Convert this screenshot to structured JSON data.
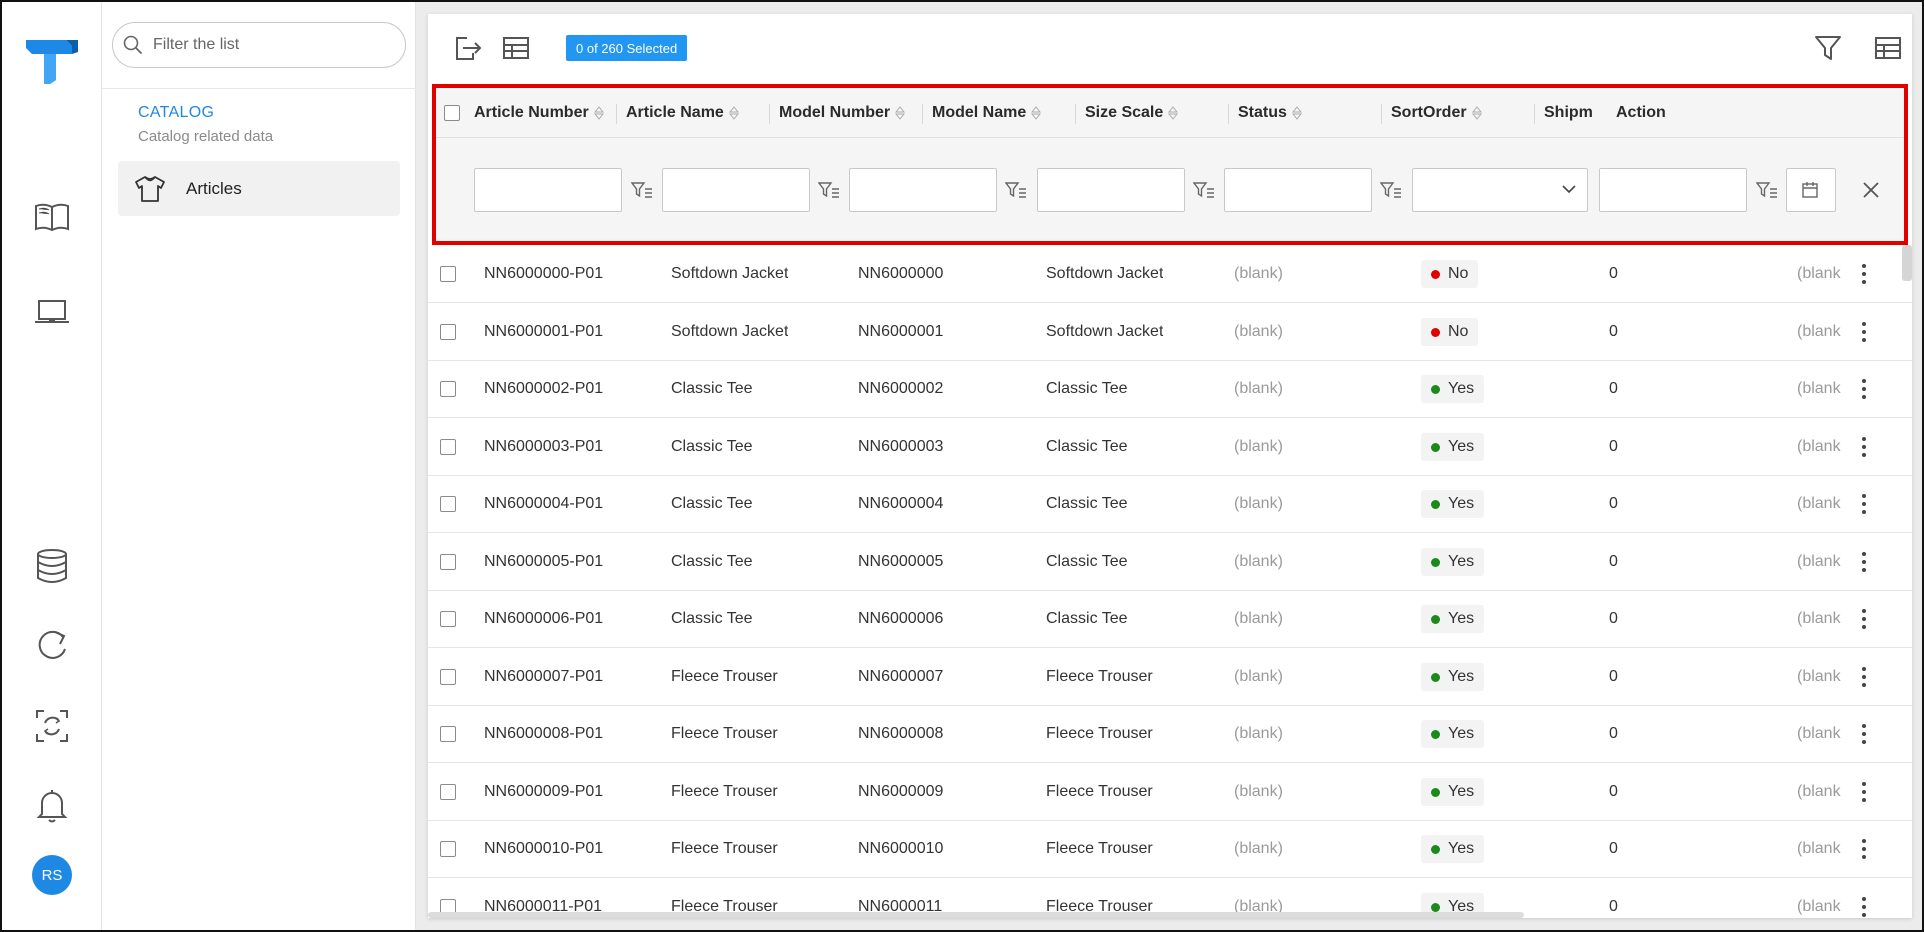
{
  "rail": {
    "logo_icon": "brand-logo",
    "icons": [
      "book-icon",
      "laptop-icon",
      "database-icon",
      "refresh-icon",
      "sync-icon",
      "bell-icon"
    ],
    "avatar_initials": "RS",
    "accent": "#1e88e5"
  },
  "panel": {
    "search_placeholder": "Filter the list",
    "section_title": "CATALOG",
    "section_subtitle": "Catalog related data",
    "nav_item": "Articles"
  },
  "toolbar": {
    "selected_badge": "0 of 260 Selected"
  },
  "columns": [
    "Article Number",
    "Article Name",
    "Model Number",
    "Model Name",
    "Size Scale",
    "Status",
    "SortOrder",
    "Shipm",
    "Action"
  ],
  "status_colors": {
    "No": "#e00000",
    "Yes": "#1a8a1a"
  },
  "highlight_color": "#e00000",
  "rows": [
    {
      "article_number": "NN6000000-P01",
      "article_name": "Softdown Jacket",
      "model_number": "NN6000000",
      "model_name": "Softdown Jacket",
      "size_scale": "(blank)",
      "status": "No",
      "sort_order": "0",
      "shipment": "(blank"
    },
    {
      "article_number": "NN6000001-P01",
      "article_name": "Softdown Jacket",
      "model_number": "NN6000001",
      "model_name": "Softdown Jacket",
      "size_scale": "(blank)",
      "status": "No",
      "sort_order": "0",
      "shipment": "(blank"
    },
    {
      "article_number": "NN6000002-P01",
      "article_name": "Classic Tee",
      "model_number": "NN6000002",
      "model_name": "Classic Tee",
      "size_scale": "(blank)",
      "status": "Yes",
      "sort_order": "0",
      "shipment": "(blank"
    },
    {
      "article_number": "NN6000003-P01",
      "article_name": "Classic Tee",
      "model_number": "NN6000003",
      "model_name": "Classic Tee",
      "size_scale": "(blank)",
      "status": "Yes",
      "sort_order": "0",
      "shipment": "(blank"
    },
    {
      "article_number": "NN6000004-P01",
      "article_name": "Classic Tee",
      "model_number": "NN6000004",
      "model_name": "Classic Tee",
      "size_scale": "(blank)",
      "status": "Yes",
      "sort_order": "0",
      "shipment": "(blank"
    },
    {
      "article_number": "NN6000005-P01",
      "article_name": "Classic Tee",
      "model_number": "NN6000005",
      "model_name": "Classic Tee",
      "size_scale": "(blank)",
      "status": "Yes",
      "sort_order": "0",
      "shipment": "(blank"
    },
    {
      "article_number": "NN6000006-P01",
      "article_name": "Classic Tee",
      "model_number": "NN6000006",
      "model_name": "Classic Tee",
      "size_scale": "(blank)",
      "status": "Yes",
      "sort_order": "0",
      "shipment": "(blank"
    },
    {
      "article_number": "NN6000007-P01",
      "article_name": "Fleece Trouser",
      "model_number": "NN6000007",
      "model_name": "Fleece Trouser",
      "size_scale": "(blank)",
      "status": "Yes",
      "sort_order": "0",
      "shipment": "(blank"
    },
    {
      "article_number": "NN6000008-P01",
      "article_name": "Fleece Trouser",
      "model_number": "NN6000008",
      "model_name": "Fleece Trouser",
      "size_scale": "(blank)",
      "status": "Yes",
      "sort_order": "0",
      "shipment": "(blank"
    },
    {
      "article_number": "NN6000009-P01",
      "article_name": "Fleece Trouser",
      "model_number": "NN6000009",
      "model_name": "Fleece Trouser",
      "size_scale": "(blank)",
      "status": "Yes",
      "sort_order": "0",
      "shipment": "(blank"
    },
    {
      "article_number": "NN6000010-P01",
      "article_name": "Fleece Trouser",
      "model_number": "NN6000010",
      "model_name": "Fleece Trouser",
      "size_scale": "(blank)",
      "status": "Yes",
      "sort_order": "0",
      "shipment": "(blank"
    },
    {
      "article_number": "NN6000011-P01",
      "article_name": "Fleece Trouser",
      "model_number": "NN6000011",
      "model_name": "Fleece Trouser",
      "size_scale": "(blank)",
      "status": "Yes",
      "sort_order": "0",
      "shipment": "(blank"
    }
  ]
}
